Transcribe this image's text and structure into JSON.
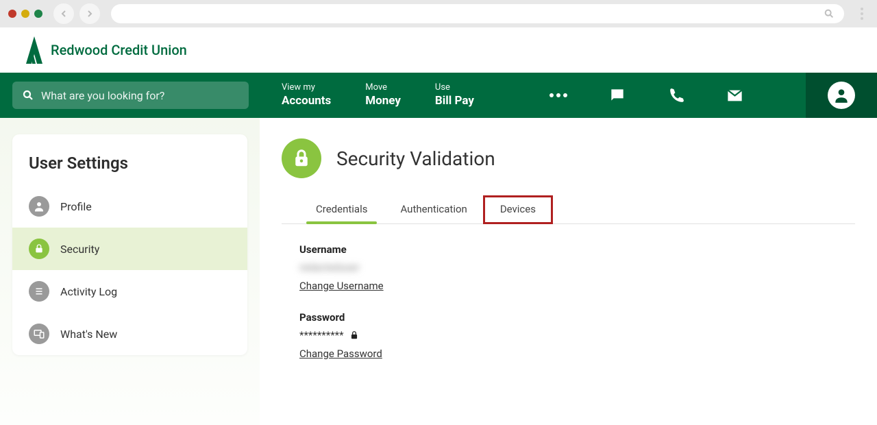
{
  "search": {
    "placeholder": "What are you looking for?"
  },
  "logo": {
    "text": "Redwood Credit Union"
  },
  "nav": {
    "links": [
      {
        "small": "View my",
        "big": "Accounts"
      },
      {
        "small": "Move",
        "big": "Money"
      },
      {
        "small": "Use",
        "big": "Bill Pay"
      }
    ]
  },
  "sidebar": {
    "title": "User Settings",
    "items": [
      {
        "label": "Profile"
      },
      {
        "label": "Security"
      },
      {
        "label": "Activity Log"
      },
      {
        "label": "What's New"
      }
    ]
  },
  "page": {
    "title": "Security Validation"
  },
  "tabs": [
    {
      "label": "Credentials"
    },
    {
      "label": "Authentication"
    },
    {
      "label": "Devices"
    }
  ],
  "credentials": {
    "username_label": "Username",
    "username_value": "redacteduser",
    "change_username": "Change Username",
    "password_label": "Password",
    "password_value": "**********",
    "change_password": "Change Password"
  }
}
